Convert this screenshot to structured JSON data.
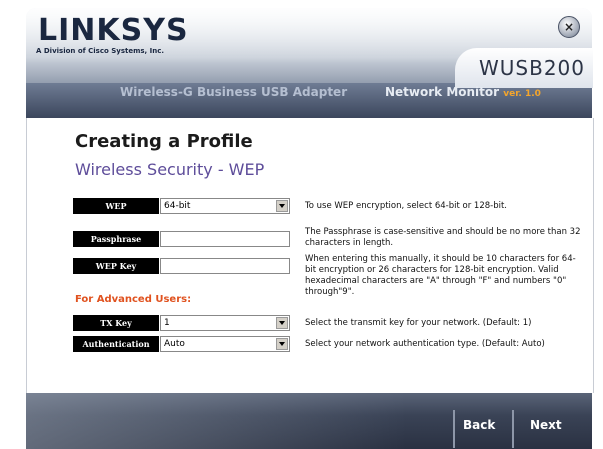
{
  "window": {
    "brand": "LINKSYS",
    "brand_sub": "A Division of Cisco Systems, Inc.",
    "close_symbol": "×",
    "model": "WUSB200",
    "product_name": "Wireless-G Business USB Adapter",
    "monitor_title": "Network Monitor",
    "version": "ver. 1.0"
  },
  "page": {
    "title": "Creating a Profile",
    "section": "Wireless Security - WEP",
    "advanced_label": "For Advanced Users:"
  },
  "fields": {
    "wep": {
      "label": "WEP",
      "value": "64-bit",
      "help": "To use WEP encryption, select 64-bit or 128-bit."
    },
    "passphrase": {
      "label": "Passphrase",
      "value": "",
      "help": "The Passphrase is case-sensitive and should be no more than 32 characters in length."
    },
    "wep_key": {
      "label": "WEP Key",
      "value": "",
      "help": "When entering this manually, it should be 10 characters for 64-bit encryption or 26 characters for 128-bit encryption. Valid hexadecimal characters are \"A\" through \"F\" and numbers \"0\" through\"9\"."
    },
    "tx_key": {
      "label": "TX Key",
      "value": "1",
      "help": "Select the transmit key for your network. (Default: 1)"
    },
    "authentication": {
      "label": "Authentication",
      "value": "Auto",
      "help": "Select your network authentication type. (Default: Auto)"
    }
  },
  "footer": {
    "back_label": "Back",
    "next_label": "Next"
  },
  "colors": {
    "accent_purple": "#5e4d9a",
    "advanced_orange": "#e0521f",
    "version_orange": "#f4a52b"
  }
}
